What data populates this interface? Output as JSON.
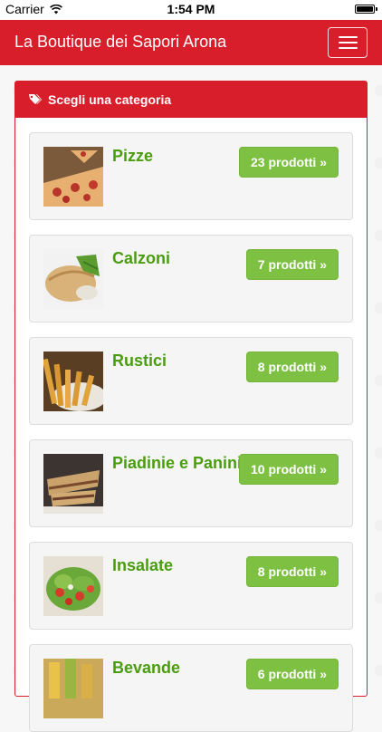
{
  "status_bar": {
    "carrier": "Carrier",
    "time": "1:54 PM"
  },
  "navbar": {
    "title": "La Boutique dei Sapori Arona"
  },
  "panel": {
    "heading": "Scegli una categoria"
  },
  "categories": [
    {
      "name": "Pizze",
      "count_label": "23 prodotti »"
    },
    {
      "name": "Calzoni",
      "count_label": "7 prodotti »"
    },
    {
      "name": "Rustici",
      "count_label": "8 prodotti »"
    },
    {
      "name": "Piadinie e Panini",
      "count_label": "10 prodotti »"
    },
    {
      "name": "Insalate",
      "count_label": "8 prodotti »"
    },
    {
      "name": "Bevande",
      "count_label": "6 prodotti »"
    }
  ],
  "colors": {
    "brand_red": "#d81e2a",
    "button_green": "#7ec142",
    "title_green": "#4a9d0f"
  }
}
